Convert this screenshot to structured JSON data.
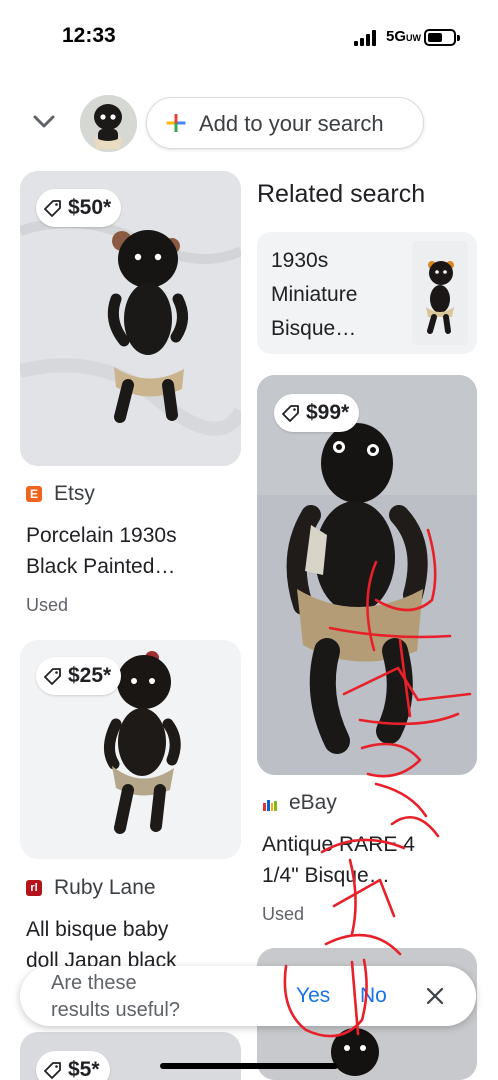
{
  "status_bar": {
    "time": "12:33",
    "network": "5G"
  },
  "header": {
    "add_to_search": "Add to your search"
  },
  "results": [
    {
      "price": "$50*",
      "source": "Etsy",
      "title_line1": "Porcelain 1930s",
      "title_line2": "Black Painted…",
      "condition": "Used"
    },
    {
      "price": "$25*",
      "source": "Ruby Lane",
      "title_line1": "All bisque baby",
      "title_line2": "doll Japan black"
    },
    {
      "price": "$5*"
    },
    {
      "price": "$99*",
      "source": "eBay",
      "title_line1": "Antique RARE 4",
      "title_line2": "1/4\" Bisque…",
      "condition": "Used"
    }
  ],
  "related": {
    "heading": "Related search",
    "line1": "1930s",
    "line2": "Miniature",
    "line3": "Bisque…"
  },
  "feedback": {
    "question_line1": "Are these",
    "question_line2": "results useful?",
    "yes": "Yes",
    "no": "No"
  },
  "colors": {
    "accent": "#1a73e8",
    "etsy": "#f1641e",
    "ruby_lane": "#b3131b",
    "annotation_ink": "#e8202a"
  },
  "icons": {
    "back": "chevron-down-icon",
    "add": "plus-icon",
    "price_tag": "tag-icon",
    "close": "close-icon"
  }
}
